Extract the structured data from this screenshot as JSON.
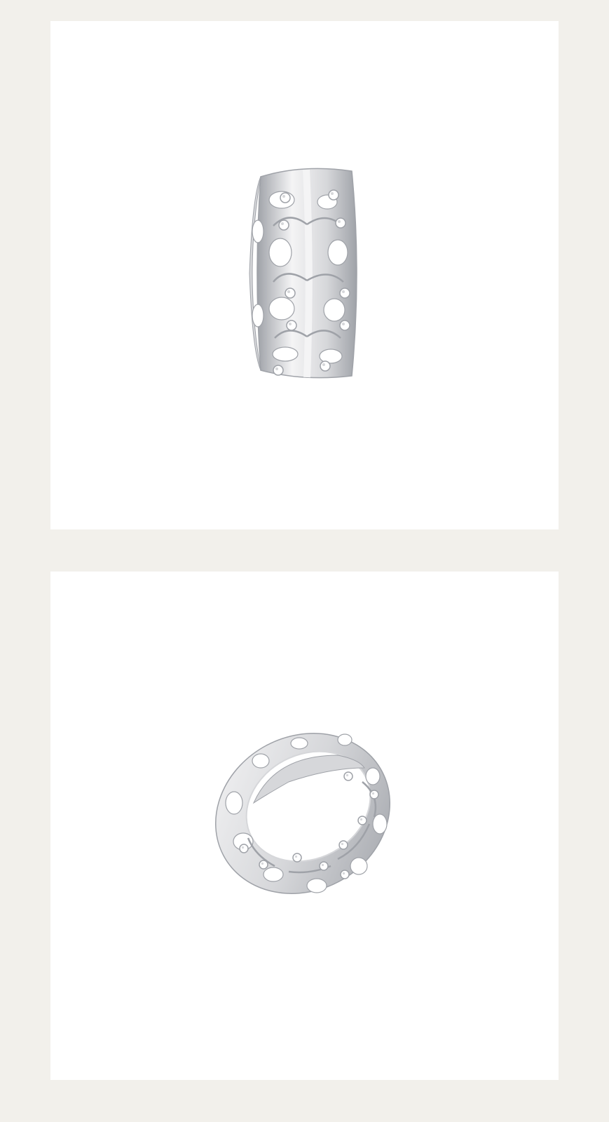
{
  "colors": {
    "page_background": "#f2f0eb",
    "panel_background": "#ffffff",
    "metal_light": "#f4f4f5",
    "metal_mid": "#d6d7da",
    "metal_dark": "#9fa2a8",
    "crystal": "#ffffff"
  },
  "panels": [
    {
      "subject": "ring-front-view-image"
    },
    {
      "subject": "ring-angled-view-image"
    }
  ]
}
